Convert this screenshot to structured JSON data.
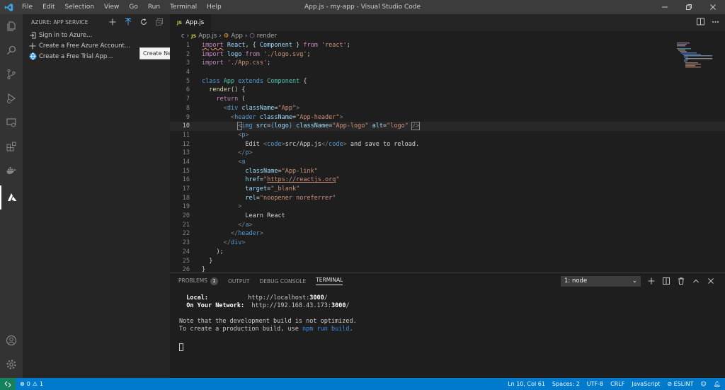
{
  "window": {
    "title": "App.js - my-app - Visual Studio Code",
    "menu": [
      "File",
      "Edit",
      "Selection",
      "View",
      "Go",
      "Run",
      "Terminal",
      "Help"
    ]
  },
  "sidebar": {
    "header": "AZURE: APP SERVICE",
    "tooltip": "Create New Web App...",
    "items": [
      {
        "label": "Sign in to Azure..."
      },
      {
        "label": "Create a Free Azure Account..."
      },
      {
        "label": "Create a Free Trial App..."
      }
    ]
  },
  "editor": {
    "tab": {
      "badge": "JS",
      "label": "App.js"
    },
    "breadcrumb": [
      "c",
      "App.js",
      "App",
      "render"
    ],
    "line_numbers": [
      "1",
      "2",
      "3",
      "4",
      "5",
      "6",
      "7",
      "8",
      "9",
      "10",
      "11",
      "12",
      "13",
      "14",
      "15",
      "16",
      "17",
      "18",
      "19",
      "20",
      "21",
      "22",
      "23",
      "24",
      "25",
      "26"
    ],
    "current_line": 10
  },
  "panel": {
    "tabs": [
      "PROBLEMS",
      "OUTPUT",
      "DEBUG CONSOLE",
      "TERMINAL"
    ],
    "problems_count": "1",
    "terminal_select": "1: node",
    "terminal": {
      "local_label": "Local:",
      "local_url_prefix": "http://localhost:",
      "local_port": "3000",
      "network_label": "On Your Network:",
      "network_url_prefix": "http://192.168.43.173:",
      "network_port": "3000",
      "note_line1": "Note that the development build is not optimized.",
      "note_line2_prefix": "To create a production build, use ",
      "note_cmd": "npm run build",
      "note_line2_suffix": "."
    }
  },
  "statusbar": {
    "errors": "0",
    "warnings": "1",
    "position": "Ln 10, Col 61",
    "spaces": "Spaces: 2",
    "encoding": "UTF-8",
    "eol": "CRLF",
    "language": "JavaScript",
    "eslint": "ESLINT"
  },
  "colors": {
    "statusbar": "#007acc",
    "activitybar": "#333333",
    "sidebar": "#252526",
    "editor": "#1e1e1e"
  }
}
